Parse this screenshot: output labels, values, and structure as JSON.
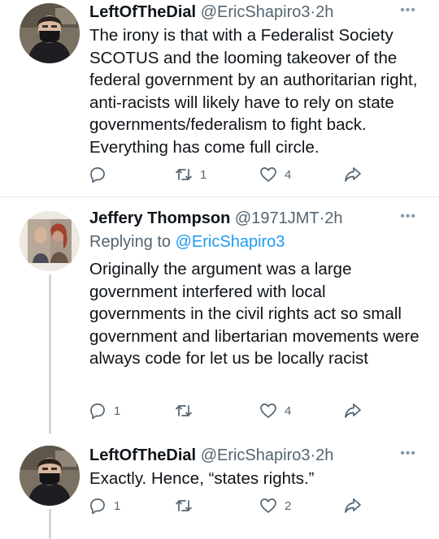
{
  "tweets": [
    {
      "name": "LeftOfTheDial",
      "handle": "@EricShapiro3",
      "dot": "·",
      "time": "2h",
      "more": "•••",
      "reply_label": "",
      "reply_handle": "",
      "text": "The irony is that with a Federalist Society SCOTUS and the looming takeover of the federal government by an authoritarian right, anti-racists will likely have to rely on state governments/federalism to fight back. Everything has come full circle.",
      "reply_count": "",
      "retweet_count": "1",
      "like_count": "4"
    },
    {
      "name": "Jeffery Thompson",
      "handle": "@1971JMT",
      "dot": "·",
      "time": "2h",
      "more": "•••",
      "reply_label": "Replying to",
      "reply_handle": "@EricShapiro3",
      "text": "Originally the argument was a large government interfered with local governments in the civil rights act so small government and libertarian movements were always code for let us be locally racist",
      "reply_count": "1",
      "retweet_count": "",
      "like_count": "4"
    },
    {
      "name": "LeftOfTheDial",
      "handle": "@EricShapiro3",
      "dot": "·",
      "time": "2h",
      "more": "•••",
      "reply_label": "",
      "reply_handle": "",
      "text": "Exactly. Hence, “states rights.”",
      "reply_count": "1",
      "retweet_count": "",
      "like_count": "2"
    }
  ],
  "icons": {
    "reply": "reply-icon",
    "retweet": "retweet-icon",
    "like": "heart-icon",
    "share": "share-icon",
    "more": "more-icon"
  },
  "colors": {
    "text": "#0f1419",
    "secondary": "#536471",
    "link": "#1d9bf0",
    "thread_line": "#cfd9de"
  }
}
